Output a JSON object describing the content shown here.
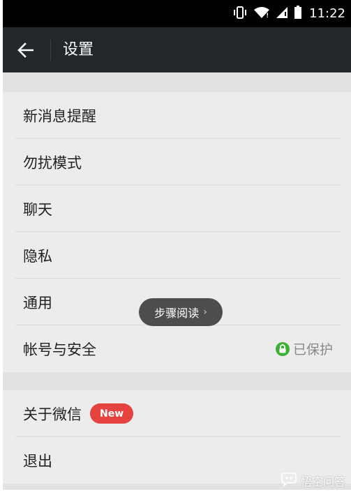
{
  "status_bar": {
    "time": "11:22",
    "icons": [
      "vibrate-icon",
      "wifi-icon",
      "signal-icon",
      "battery-icon"
    ]
  },
  "app_bar": {
    "back_icon": "arrow-left-icon",
    "title": "设置"
  },
  "settings_group_1": [
    {
      "label": "新消息提醒"
    },
    {
      "label": "勿扰模式"
    },
    {
      "label": "聊天"
    },
    {
      "label": "隐私"
    },
    {
      "label": "通用"
    },
    {
      "label": "帐号与安全",
      "status": "已保护",
      "status_icon": "lock-icon"
    }
  ],
  "settings_group_2": [
    {
      "label": "关于微信",
      "badge": "New"
    },
    {
      "label": "退出"
    }
  ],
  "toast": {
    "text": "步骤阅读",
    "chevron": "›"
  },
  "watermark": {
    "text": "悟空问答"
  },
  "colors": {
    "app_bar": "#21272a",
    "background": "#e2e2e2",
    "list_bg": "#ececec",
    "badge_red": "#e64340",
    "lock_green": "#3cb034"
  }
}
